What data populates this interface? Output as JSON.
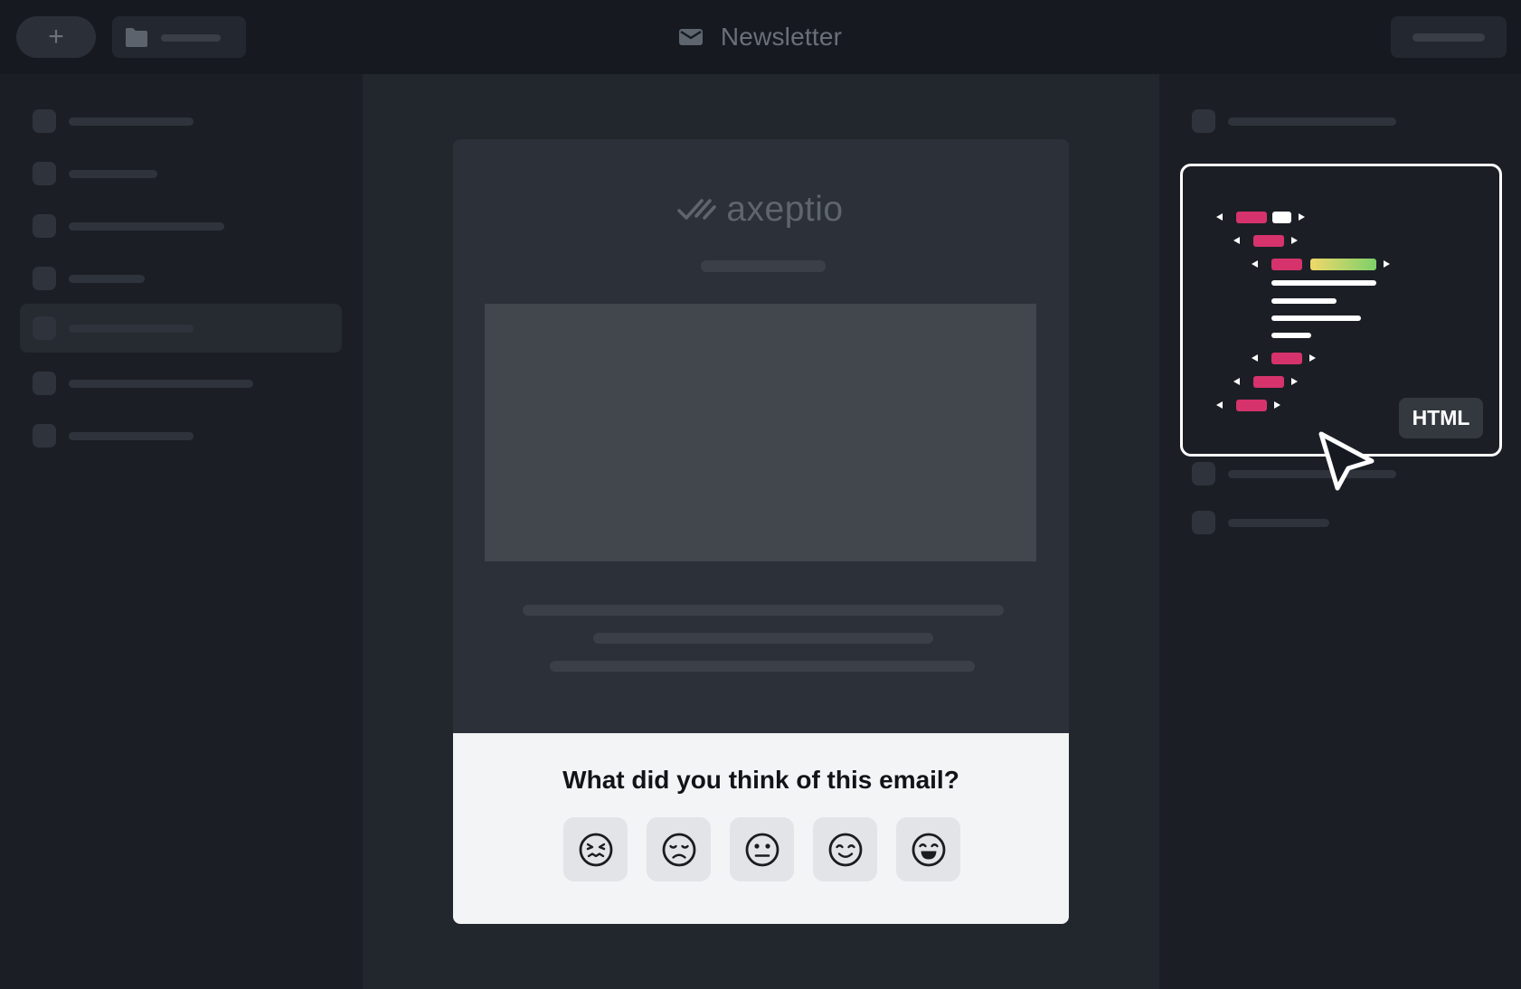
{
  "header": {
    "title": "Newsletter",
    "add_button_symbol": "+",
    "icons": {
      "add": "plus-icon",
      "folder": "folder-icon",
      "title": "envelope-icon"
    }
  },
  "email": {
    "brand": "axeptio",
    "feedback": {
      "question": "What did you think of this email?",
      "ratings": [
        {
          "name": "very-unhappy-face-icon"
        },
        {
          "name": "sad-face-icon"
        },
        {
          "name": "neutral-face-icon"
        },
        {
          "name": "happy-face-icon"
        },
        {
          "name": "very-happy-face-icon"
        }
      ]
    }
  },
  "code_preview": {
    "badge": "HTML",
    "colors": {
      "tag": "#d6336c",
      "highlight_start": "#f0d86a",
      "highlight_end": "#7ed06a",
      "text": "#ffffff"
    }
  },
  "colors": {
    "topbar": "#161a20",
    "panel": "#1b1f25",
    "canvas": "#22262d",
    "card": "#2c3038",
    "feedback_bg": "#f3f4f6"
  }
}
